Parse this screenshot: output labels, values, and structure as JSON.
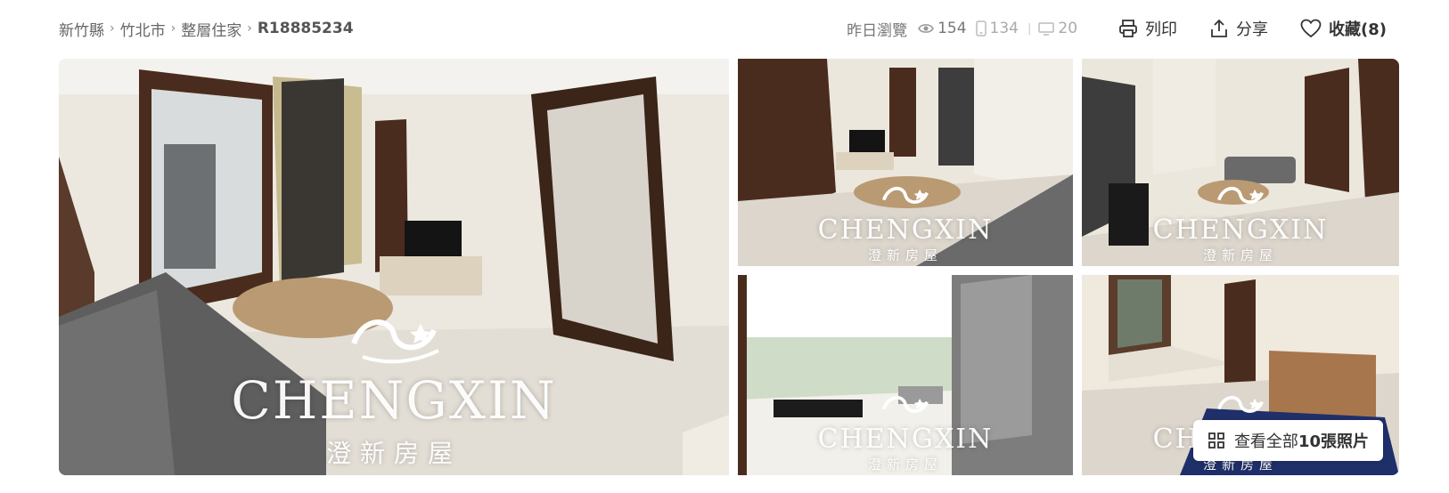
{
  "breadcrumb": {
    "items": [
      "新竹縣",
      "竹北市",
      "整層住家",
      "R18885234"
    ]
  },
  "stats": {
    "label": "昨日瀏覽",
    "total": "154",
    "mobile": "134",
    "desktop": "20"
  },
  "actions": {
    "print": "列印",
    "share": "分享",
    "favorite": "收藏(8)"
  },
  "gallery": {
    "watermark_brand": "CHENGXIN",
    "watermark_cn": "澄新房屋",
    "view_all_prefix": "查看全部",
    "view_all_count": "10張照片"
  },
  "colors": {
    "accent": "#333333",
    "muted": "#888888"
  }
}
